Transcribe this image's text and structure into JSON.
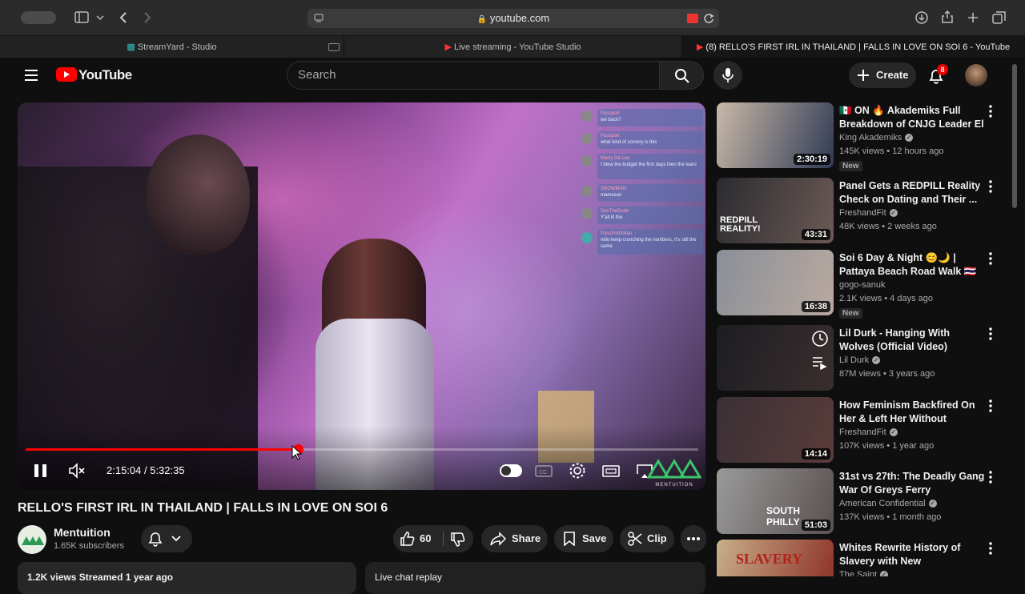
{
  "browser": {
    "url": "youtube.com",
    "tabs": [
      {
        "label": "StreamYard - Studio"
      },
      {
        "label": "Live streaming - YouTube Studio"
      },
      {
        "label": "(8) RELLO'S FIRST IRL IN THAILAND | FALLS IN LOVE ON SOI 6 - YouTube"
      }
    ]
  },
  "header": {
    "logo_text": "YouTube",
    "search_placeholder": "Search",
    "create_label": "Create",
    "notification_count": "8"
  },
  "player": {
    "current_time": "2:15:04",
    "separator": " / ",
    "duration": "5:32:35",
    "progress_fraction": 0.405,
    "watermark": "MENTUITION",
    "chat": [
      {
        "user": "Passport",
        "text": "we back?"
      },
      {
        "user": "Passport",
        "text": "what kind of sorcery is this"
      },
      {
        "user": "Marry Da Lee",
        "text": "I blew the budget the first days then the tears"
      },
      {
        "user": "SNOWMAN",
        "text": "mamason"
      },
      {
        "user": "DevTheDude",
        "text": "Y'all lit tho"
      },
      {
        "user": "PassPortXilian",
        "text": "rello keep crunching the numbers, it's still the same"
      }
    ]
  },
  "video": {
    "title": "RELLO'S FIRST IRL IN THAILAND | FALLS IN LOVE ON SOI 6",
    "channel_name": "Mentuition",
    "subscribers": "1.65K subscribers",
    "like_count": "60",
    "share_label": "Share",
    "save_label": "Save",
    "clip_label": "Clip",
    "description_preview": "1.2K views  Streamed 1 year ago",
    "live_chat_label": "Live chat replay"
  },
  "recommendations": [
    {
      "title": "🇲🇽 ON 🔥 Akademiks Full Breakdown of CNJG Leader El ...",
      "channel": "King Akademiks",
      "meta": "145K views • 12 hours ago",
      "badge": "New",
      "duration": "2:30:19",
      "colors": [
        "#c9b9a8",
        "#303a55"
      ]
    },
    {
      "title": "Panel Gets a REDPILL Reality Check on Dating and Their ...",
      "channel": "FreshandFit",
      "meta": "48K views • 2 weeks ago",
      "badge": "",
      "duration": "43:31",
      "colors": [
        "#2b2b30",
        "#6b5a55"
      ]
    },
    {
      "title": "Soi 6 Day & Night 😊🌙 | Pattaya Beach Road Walk 🇹🇭",
      "channel": "gogo-sanuk",
      "meta": "2.1K views • 4 days ago",
      "badge": "New",
      "duration": "16:38",
      "colors": [
        "#8a8f98",
        "#b9a9a0"
      ]
    },
    {
      "title": "Lil Durk - Hanging With Wolves (Official Video)",
      "channel": "Lil Durk",
      "meta": "87M views • 3 years ago",
      "badge": "",
      "duration": "",
      "colors": [
        "#1d1d22",
        "#3a2e2e"
      ]
    },
    {
      "title": "How Feminism Backfired On Her & Left Her Without Options!",
      "channel": "FreshandFit",
      "meta": "107K views • 1 year ago",
      "badge": "",
      "duration": "14:14",
      "colors": [
        "#3a3035",
        "#5a3c3a"
      ]
    },
    {
      "title": "31st vs 27th: The Deadly Gang War Of Greys Ferry",
      "channel": "American Confidential",
      "meta": "137K views • 1 month ago",
      "badge": "",
      "duration": "51:03",
      "colors": [
        "#9a9a9a",
        "#5a5050"
      ]
    },
    {
      "title": "Whites Rewrite History of Slavery with New Documentar...",
      "channel": "The Saint",
      "meta": "",
      "badge": "",
      "duration": "",
      "colors": [
        "#c9b08a",
        "#8a2a22"
      ]
    }
  ],
  "colors": {
    "accent": "#ff0000",
    "background": "#0f0f0f",
    "surface": "#272727"
  }
}
